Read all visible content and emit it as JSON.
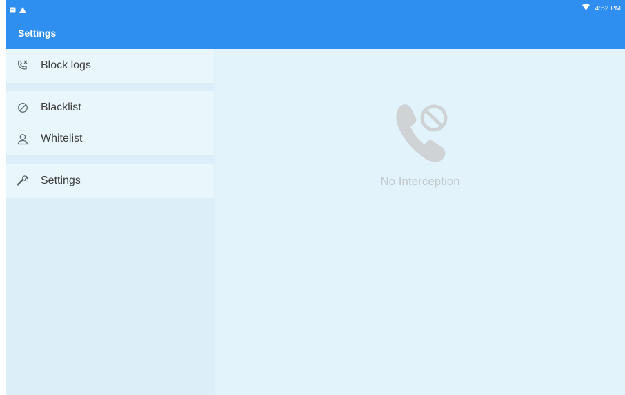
{
  "status_bar": {
    "left_icons": [
      "notification-icon",
      "warning-icon"
    ],
    "right_icons": [
      "wifi-icon"
    ],
    "time": "4:52 PM"
  },
  "app_bar": {
    "title": "Settings"
  },
  "sidebar": {
    "items": [
      {
        "label": "Block logs",
        "icon": "phone-block-icon"
      },
      {
        "label": "Blacklist",
        "icon": "block-circle-icon"
      },
      {
        "label": "Whitelist",
        "icon": "person-icon"
      },
      {
        "label": "Settings",
        "icon": "wrench-icon"
      }
    ]
  },
  "main": {
    "empty_state": {
      "icon": "phone-blocked-icon",
      "text": "No Interception"
    }
  },
  "colors": {
    "accent": "#2f8ff0",
    "content_background": "#e2f3fb",
    "sidebar_item_background": "#e9f6fc",
    "text": "#3d3d3d",
    "muted": "#c2c8cb"
  }
}
